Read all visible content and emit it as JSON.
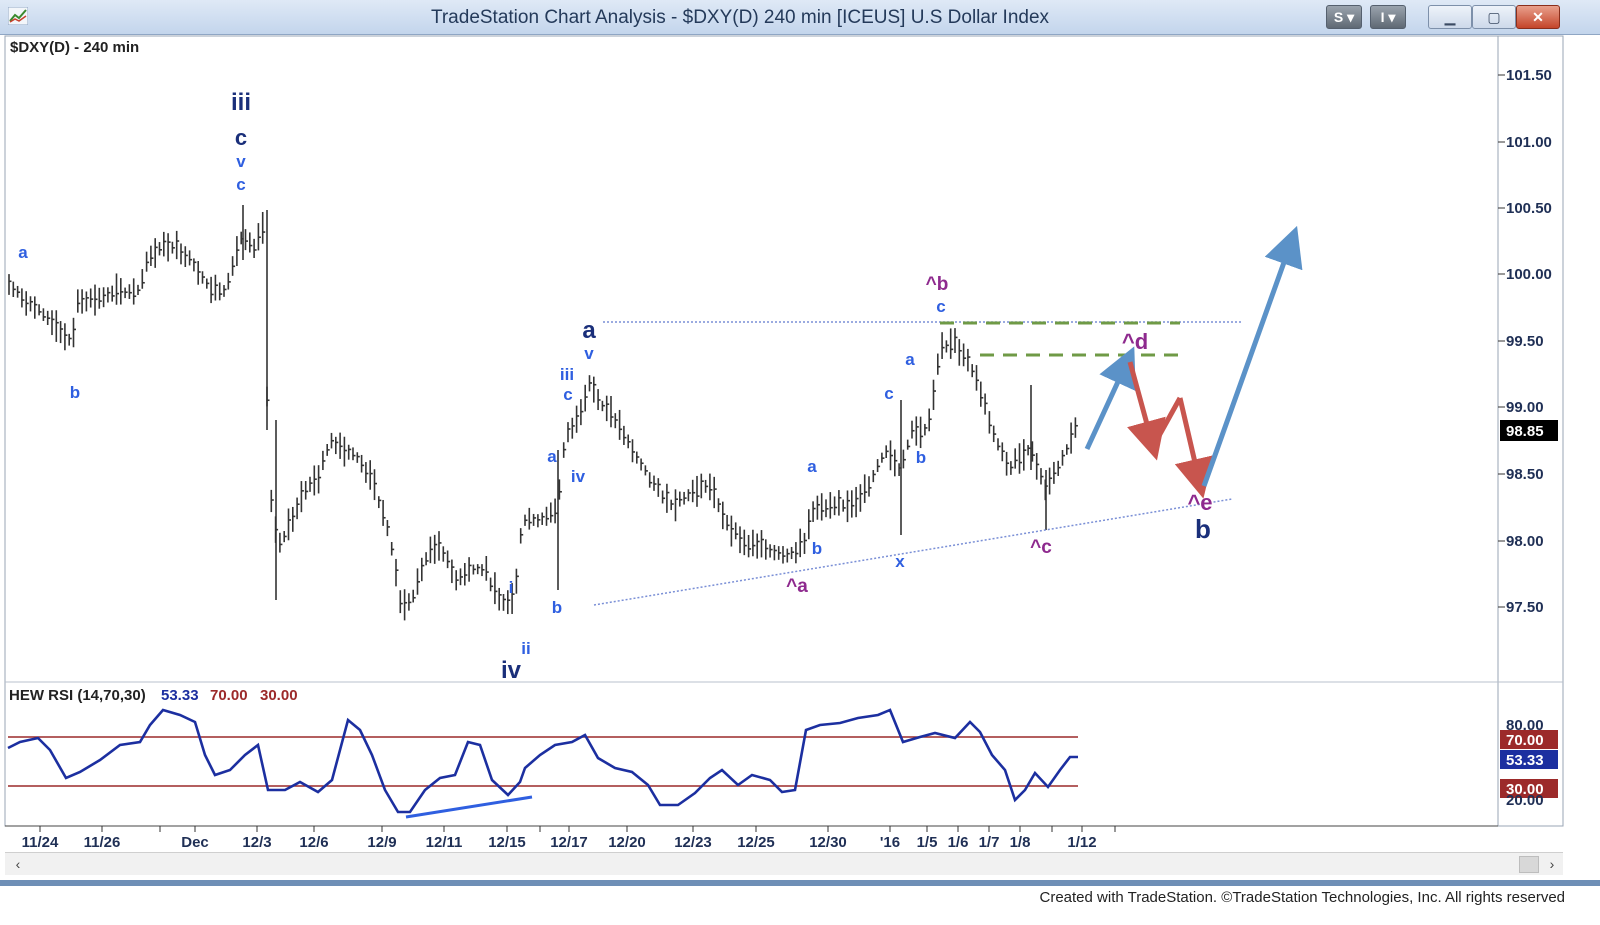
{
  "window": {
    "title": "TradeStation Chart Analysis - $DXY(D) 240 min [ICEUS] U.S Dollar Index",
    "toolbar_buttons": [
      "S",
      "I"
    ],
    "window_controls": [
      "minimize",
      "maximize",
      "close"
    ]
  },
  "chart_label": "$DXY(D) - 240 min",
  "price_axis": {
    "ticks": [
      "101.50",
      "101.00",
      "100.50",
      "100.00",
      "99.50",
      "99.00",
      "98.50",
      "98.00",
      "97.50"
    ],
    "last_price": "98.85"
  },
  "rsi_panel": {
    "label": "HEW RSI (14,70,30)",
    "value": "53.33",
    "upper": "70.00",
    "lower": "30.00",
    "ticks": [
      "80.00",
      "20.00"
    ]
  },
  "time_axis": {
    "ticks": [
      "11/24",
      "11/26",
      "Dec",
      "12/3",
      "12/6",
      "12/9",
      "12/11",
      "12/15",
      "12/17",
      "12/20",
      "12/23",
      "12/25",
      "12/30",
      "'16",
      "1/5",
      "1/6",
      "1/7",
      "1/8",
      "1/12"
    ]
  },
  "wave_labels": {
    "iii_top": "iii",
    "c_top": "c",
    "v_top": "v",
    "c_top2": "c",
    "a_left": "a",
    "b_left": "b",
    "iv_big": "iv",
    "ii": "ii",
    "i": "i",
    "a_big": "a",
    "v_a": "v",
    "iii_a": "iii",
    "c_a": "c",
    "a_small": "a",
    "iv_small": "iv",
    "b_small": "b",
    "a_mid": "a",
    "b_mid": "b",
    "x_mid": "x",
    "c_right": "c",
    "a_right": "a",
    "b_right": "b",
    "c_peak": "c",
    "hb": "^b",
    "ha": "^a",
    "hc": "^c",
    "hd": "^d",
    "he": "^e",
    "b_big": "b"
  },
  "footer": {
    "copyright": "Created with TradeStation. ©TradeStation Technologies, Inc. All rights reserved"
  },
  "colors": {
    "wave_blue": "#2f5fe0",
    "wave_navy": "#1a2f7a",
    "wave_purple": "#8e2a8e",
    "projection_blue": "#5b92c8",
    "projection_red": "#c8554e",
    "triangle_line": "#7a8fd6",
    "resistance_dash": "#6f9a46",
    "rsi_line": "#1c2fa0",
    "rsi_band": "#9c2a2a",
    "price_bars": "#333333"
  },
  "chart_data": {
    "type": "line",
    "title": "",
    "series": [
      {
        "name": "$DXY(D) - 240 min",
        "x": [
          "11/24",
          "11/26",
          "Dec",
          "12/3",
          "12/6",
          "12/9",
          "12/11",
          "12/15",
          "12/17",
          "12/20",
          "12/23",
          "12/25",
          "12/30",
          "'16",
          "1/5",
          "1/6",
          "1/7",
          "1/8",
          "1/12"
        ],
        "values": [
          99.8,
          99.8,
          100.1,
          98.6,
          98.6,
          97.5,
          97.9,
          97.7,
          99.1,
          98.8,
          98.3,
          97.9,
          98.2,
          98.6,
          99.6,
          99.3,
          98.5,
          98.3,
          98.85
        ]
      },
      {
        "name": "HEW RSI (14,70,30)",
        "x": [
          "11/24",
          "11/26",
          "Dec",
          "12/3",
          "12/6",
          "12/9",
          "12/11",
          "12/15",
          "12/17",
          "12/20",
          "12/23",
          "12/25",
          "12/30",
          "'16",
          "1/5",
          "1/6",
          "1/7",
          "1/8",
          "1/12"
        ],
        "values": [
          62,
          58,
          72,
          34,
          42,
          20,
          35,
          26,
          62,
          46,
          30,
          36,
          78,
          80,
          65,
          60,
          32,
          36,
          53
        ]
      }
    ],
    "ylim": [
      96.9,
      101.8
    ]
  }
}
